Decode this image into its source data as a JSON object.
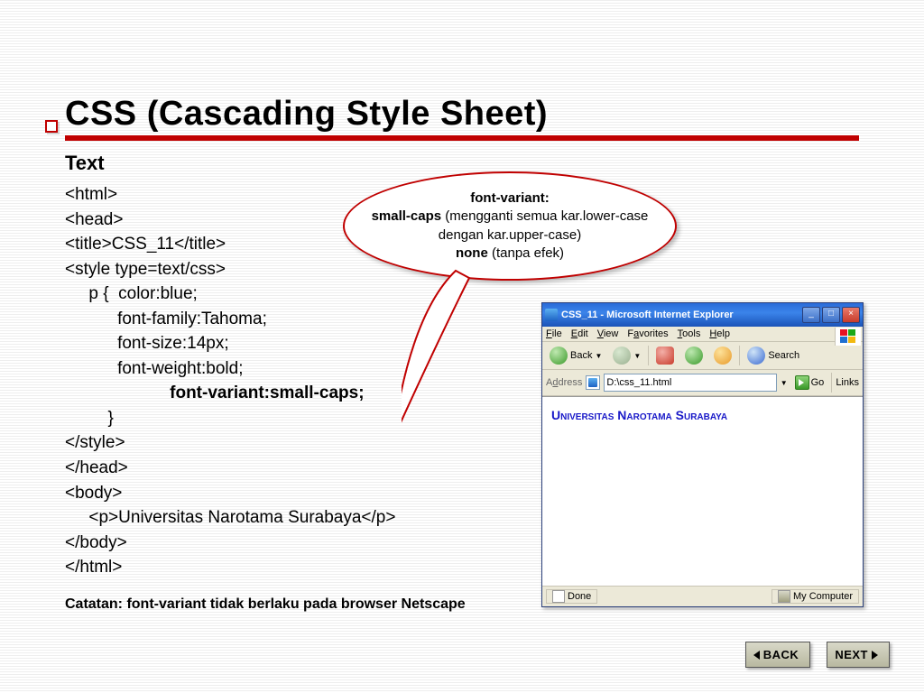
{
  "title": "CSS (Cascading Style Sheet)",
  "subhead": "Text",
  "code": {
    "l1": "<html>",
    "l2": "<head>",
    "l3": "<title>CSS_11</title>",
    "l4": "<style type=text/css>",
    "l5": "     p {  color:blue;",
    "l6": "           font-family:Tahoma;",
    "l7": "           font-size:14px;",
    "l8": "           font-weight:bold;",
    "l9": "           font-variant:small-caps;",
    "l10": "         }",
    "l11": "</style>",
    "l12": "</head>",
    "l13": "<body>",
    "l14": "     <p>Universitas Narotama Surabaya</p>",
    "l15": "</body>",
    "l16": "</html>"
  },
  "note": "Catatan: font-variant tidak berlaku pada browser Netscape",
  "bubble": {
    "h1": "font-variant:",
    "b1": "small-caps",
    "t1": " (mengganti semua kar.lower-case dengan kar.upper-case)",
    "b2": "none",
    "t2": " (tanpa efek)"
  },
  "ie": {
    "title": "CSS_11 - Microsoft Internet Explorer",
    "menu": {
      "file": "File",
      "edit": "Edit",
      "view": "View",
      "fav": "Favorites",
      "tools": "Tools",
      "help": "Help"
    },
    "toolbar": {
      "back": "Back",
      "search": "Search"
    },
    "addr": {
      "label": "Address",
      "value": "D:\\css_11.html",
      "go": "Go",
      "links": "Links"
    },
    "content": "Universitas Narotama Surabaya",
    "status": {
      "done": "Done",
      "zone": "My Computer"
    }
  },
  "nav": {
    "back": "BACK",
    "next": "NEXT"
  }
}
